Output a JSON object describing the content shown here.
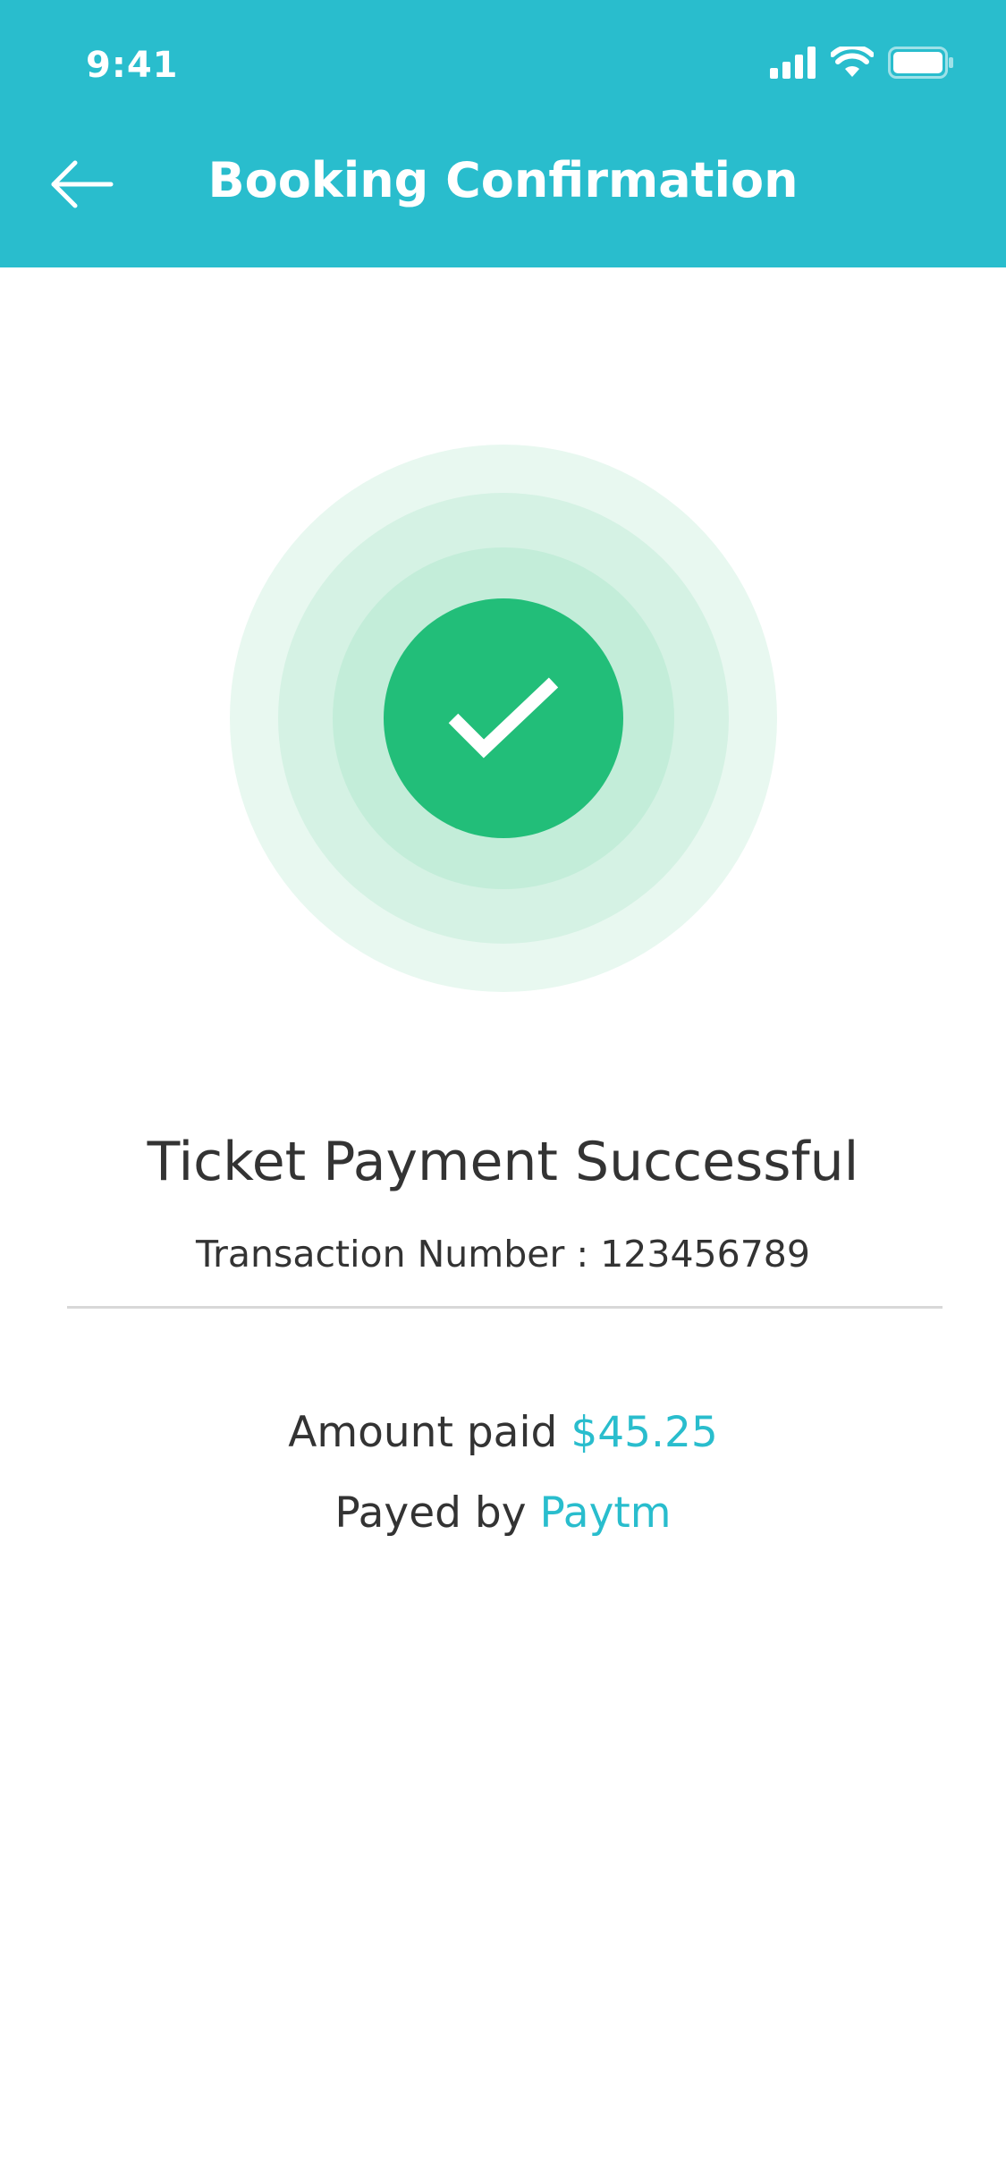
{
  "status_bar": {
    "time": "9:41",
    "icons": [
      "cellular-signal-icon",
      "wifi-icon",
      "battery-icon"
    ]
  },
  "header": {
    "back_icon": "arrow-left-icon",
    "title": "Booking Confirmation"
  },
  "success": {
    "icon": "checkmark-icon",
    "title": "Ticket Payment Successful",
    "transaction_label": "Transaction Number : 123456789"
  },
  "payment": {
    "amount_label": "Amount paid",
    "amount_value": "$45.25",
    "payed_by_label": "Payed by",
    "payed_by_value": "Paytm"
  },
  "colors": {
    "brand": "#29BDCD",
    "success": "#22BE79",
    "text": "#333333",
    "divider": "#D8D8D8"
  }
}
